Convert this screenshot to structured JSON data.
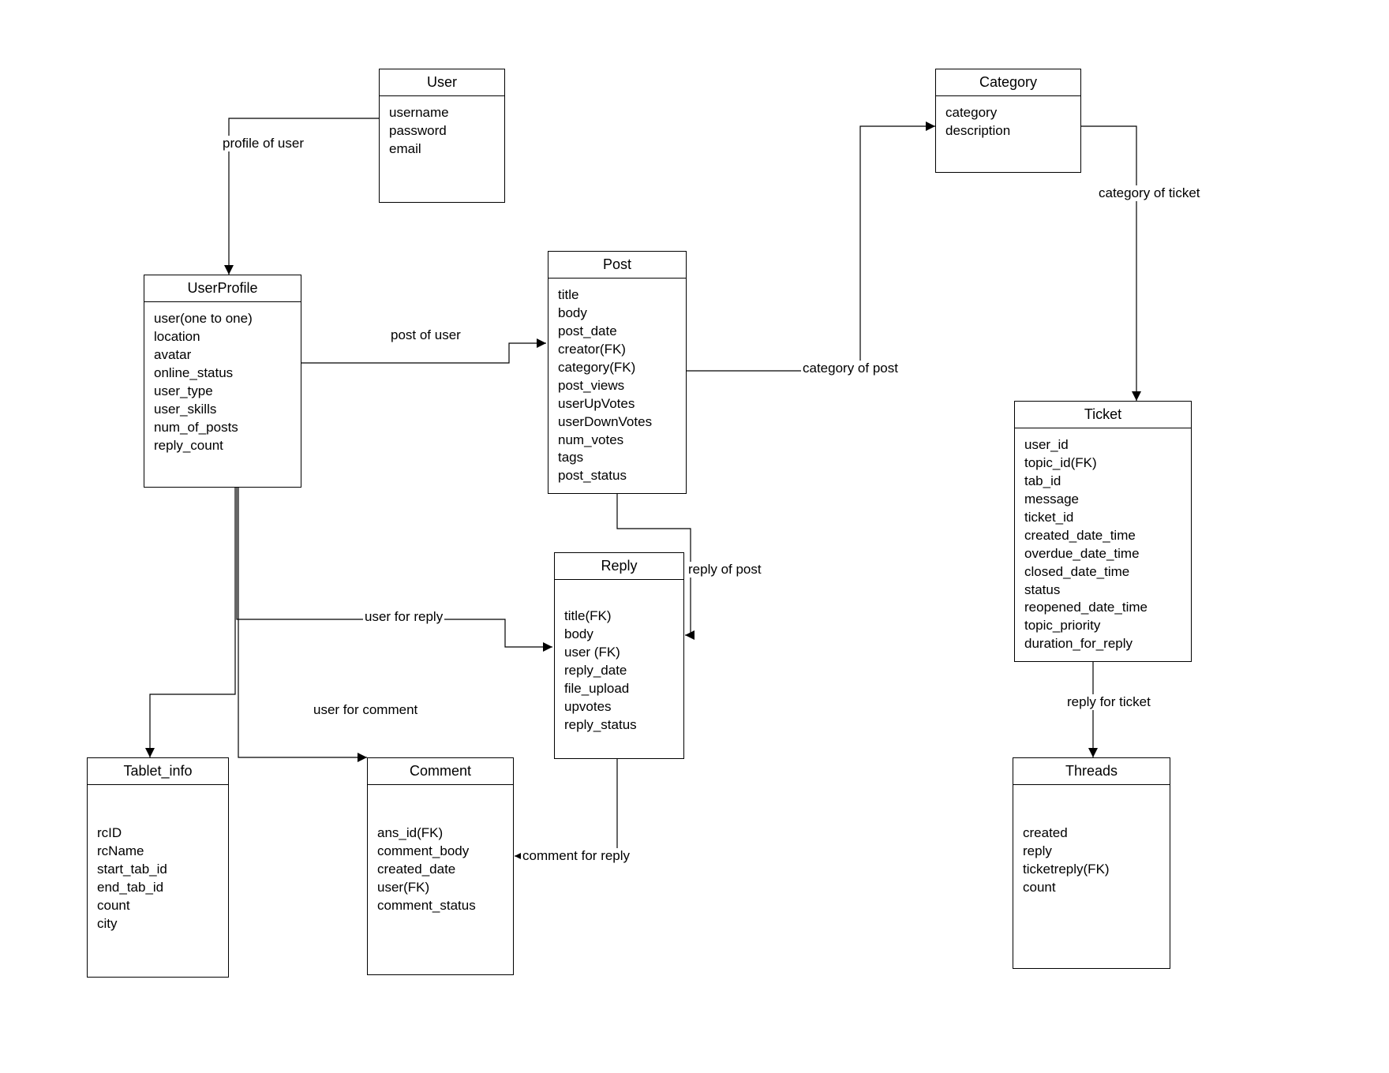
{
  "entities": {
    "user": {
      "title": "User",
      "attrs": [
        "username",
        "password",
        "email"
      ]
    },
    "category": {
      "title": "Category",
      "attrs": [
        "category",
        "description"
      ]
    },
    "userprofile": {
      "title": "UserProfile",
      "attrs": [
        "user(one to one)",
        "location",
        "avatar",
        "online_status",
        "user_type",
        "user_skills",
        "num_of_posts",
        "reply_count"
      ]
    },
    "post": {
      "title": "Post",
      "attrs": [
        "title",
        "body",
        "post_date",
        "creator(FK)",
        "category(FK)",
        "post_views",
        "userUpVotes",
        "userDownVotes",
        "num_votes",
        "tags",
        "post_status"
      ]
    },
    "ticket": {
      "title": "Ticket",
      "attrs": [
        "user_id",
        "topic_id(FK)",
        "tab_id",
        "message",
        "ticket_id",
        "created_date_time",
        "overdue_date_time",
        "closed_date_time",
        "status",
        "reopened_date_time",
        "topic_priority",
        "duration_for_reply"
      ]
    },
    "reply": {
      "title": "Reply",
      "attrs": [
        "title(FK)",
        "body",
        "user (FK)",
        "reply_date",
        "file_upload",
        "upvotes",
        "reply_status"
      ]
    },
    "tablet": {
      "title": "Tablet_info",
      "attrs": [
        "rcID",
        "rcName",
        "start_tab_id",
        "end_tab_id",
        "count",
        "city"
      ]
    },
    "comment": {
      "title": "Comment",
      "attrs": [
        "ans_id(FK)",
        "comment_body",
        "created_date",
        "user(FK)",
        "comment_status"
      ]
    },
    "threads": {
      "title": "Threads",
      "attrs": [
        "created",
        "reply",
        "ticketreply(FK)",
        "count"
      ]
    }
  },
  "relations": {
    "profile_of_user": "profile of user",
    "post_of_user": "post of user",
    "category_of_post": "category of post",
    "category_of_ticket": "category of ticket",
    "reply_of_post": "reply of post",
    "user_for_reply": "user for reply",
    "user_for_comment": "user for comment",
    "comment_for_reply": "comment for reply",
    "reply_for_ticket": "reply for ticket"
  }
}
